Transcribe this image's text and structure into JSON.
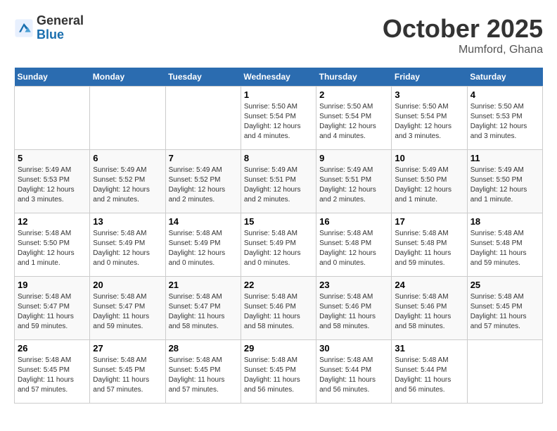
{
  "header": {
    "logo_general": "General",
    "logo_blue": "Blue",
    "month": "October 2025",
    "location": "Mumford, Ghana"
  },
  "days_of_week": [
    "Sunday",
    "Monday",
    "Tuesday",
    "Wednesday",
    "Thursday",
    "Friday",
    "Saturday"
  ],
  "weeks": [
    [
      {
        "day": "",
        "info": ""
      },
      {
        "day": "",
        "info": ""
      },
      {
        "day": "",
        "info": ""
      },
      {
        "day": "1",
        "info": "Sunrise: 5:50 AM\nSunset: 5:54 PM\nDaylight: 12 hours\nand 4 minutes."
      },
      {
        "day": "2",
        "info": "Sunrise: 5:50 AM\nSunset: 5:54 PM\nDaylight: 12 hours\nand 4 minutes."
      },
      {
        "day": "3",
        "info": "Sunrise: 5:50 AM\nSunset: 5:54 PM\nDaylight: 12 hours\nand 3 minutes."
      },
      {
        "day": "4",
        "info": "Sunrise: 5:50 AM\nSunset: 5:53 PM\nDaylight: 12 hours\nand 3 minutes."
      }
    ],
    [
      {
        "day": "5",
        "info": "Sunrise: 5:49 AM\nSunset: 5:53 PM\nDaylight: 12 hours\nand 3 minutes."
      },
      {
        "day": "6",
        "info": "Sunrise: 5:49 AM\nSunset: 5:52 PM\nDaylight: 12 hours\nand 2 minutes."
      },
      {
        "day": "7",
        "info": "Sunrise: 5:49 AM\nSunset: 5:52 PM\nDaylight: 12 hours\nand 2 minutes."
      },
      {
        "day": "8",
        "info": "Sunrise: 5:49 AM\nSunset: 5:51 PM\nDaylight: 12 hours\nand 2 minutes."
      },
      {
        "day": "9",
        "info": "Sunrise: 5:49 AM\nSunset: 5:51 PM\nDaylight: 12 hours\nand 2 minutes."
      },
      {
        "day": "10",
        "info": "Sunrise: 5:49 AM\nSunset: 5:50 PM\nDaylight: 12 hours\nand 1 minute."
      },
      {
        "day": "11",
        "info": "Sunrise: 5:49 AM\nSunset: 5:50 PM\nDaylight: 12 hours\nand 1 minute."
      }
    ],
    [
      {
        "day": "12",
        "info": "Sunrise: 5:48 AM\nSunset: 5:50 PM\nDaylight: 12 hours\nand 1 minute."
      },
      {
        "day": "13",
        "info": "Sunrise: 5:48 AM\nSunset: 5:49 PM\nDaylight: 12 hours\nand 0 minutes."
      },
      {
        "day": "14",
        "info": "Sunrise: 5:48 AM\nSunset: 5:49 PM\nDaylight: 12 hours\nand 0 minutes."
      },
      {
        "day": "15",
        "info": "Sunrise: 5:48 AM\nSunset: 5:49 PM\nDaylight: 12 hours\nand 0 minutes."
      },
      {
        "day": "16",
        "info": "Sunrise: 5:48 AM\nSunset: 5:48 PM\nDaylight: 12 hours\nand 0 minutes."
      },
      {
        "day": "17",
        "info": "Sunrise: 5:48 AM\nSunset: 5:48 PM\nDaylight: 11 hours\nand 59 minutes."
      },
      {
        "day": "18",
        "info": "Sunrise: 5:48 AM\nSunset: 5:48 PM\nDaylight: 11 hours\nand 59 minutes."
      }
    ],
    [
      {
        "day": "19",
        "info": "Sunrise: 5:48 AM\nSunset: 5:47 PM\nDaylight: 11 hours\nand 59 minutes."
      },
      {
        "day": "20",
        "info": "Sunrise: 5:48 AM\nSunset: 5:47 PM\nDaylight: 11 hours\nand 59 minutes."
      },
      {
        "day": "21",
        "info": "Sunrise: 5:48 AM\nSunset: 5:47 PM\nDaylight: 11 hours\nand 58 minutes."
      },
      {
        "day": "22",
        "info": "Sunrise: 5:48 AM\nSunset: 5:46 PM\nDaylight: 11 hours\nand 58 minutes."
      },
      {
        "day": "23",
        "info": "Sunrise: 5:48 AM\nSunset: 5:46 PM\nDaylight: 11 hours\nand 58 minutes."
      },
      {
        "day": "24",
        "info": "Sunrise: 5:48 AM\nSunset: 5:46 PM\nDaylight: 11 hours\nand 58 minutes."
      },
      {
        "day": "25",
        "info": "Sunrise: 5:48 AM\nSunset: 5:45 PM\nDaylight: 11 hours\nand 57 minutes."
      }
    ],
    [
      {
        "day": "26",
        "info": "Sunrise: 5:48 AM\nSunset: 5:45 PM\nDaylight: 11 hours\nand 57 minutes."
      },
      {
        "day": "27",
        "info": "Sunrise: 5:48 AM\nSunset: 5:45 PM\nDaylight: 11 hours\nand 57 minutes."
      },
      {
        "day": "28",
        "info": "Sunrise: 5:48 AM\nSunset: 5:45 PM\nDaylight: 11 hours\nand 57 minutes."
      },
      {
        "day": "29",
        "info": "Sunrise: 5:48 AM\nSunset: 5:45 PM\nDaylight: 11 hours\nand 56 minutes."
      },
      {
        "day": "30",
        "info": "Sunrise: 5:48 AM\nSunset: 5:44 PM\nDaylight: 11 hours\nand 56 minutes."
      },
      {
        "day": "31",
        "info": "Sunrise: 5:48 AM\nSunset: 5:44 PM\nDaylight: 11 hours\nand 56 minutes."
      },
      {
        "day": "",
        "info": ""
      }
    ]
  ]
}
